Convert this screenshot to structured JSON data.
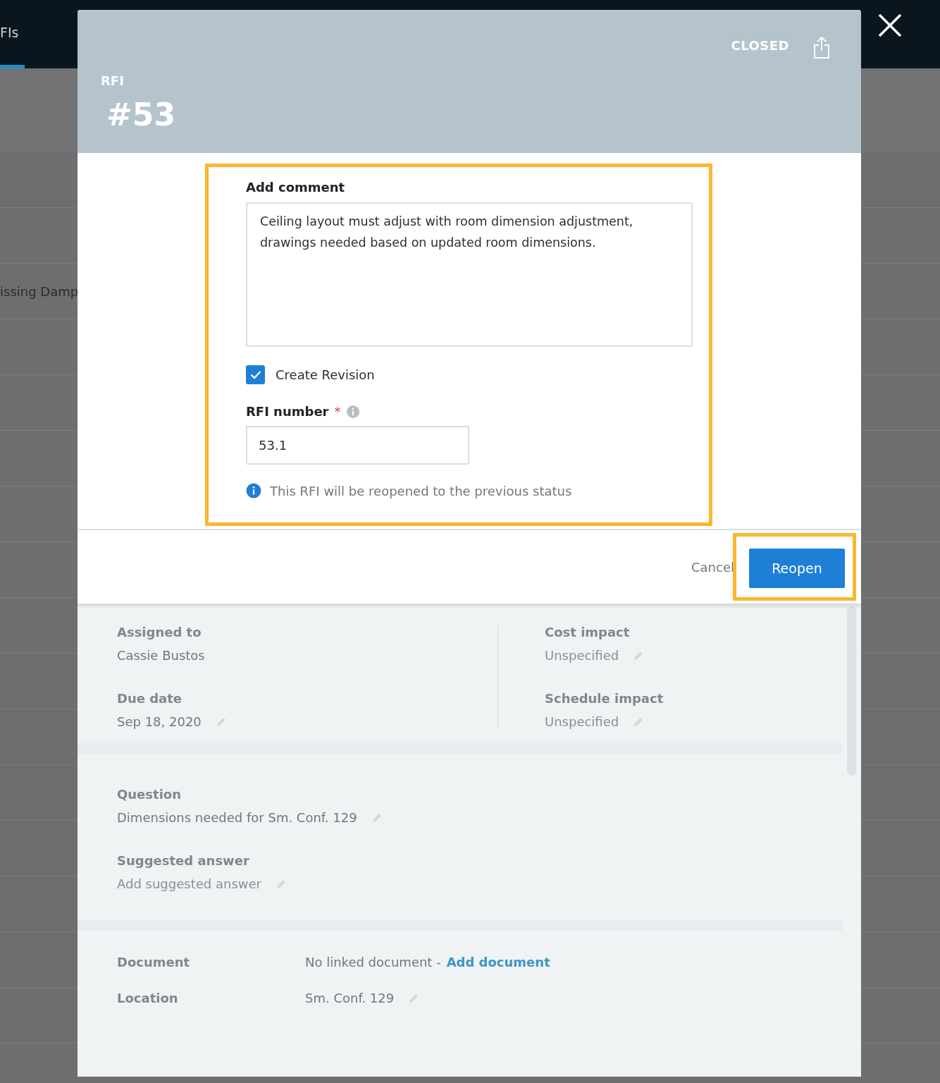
{
  "background": {
    "tab": {
      "label": "FIs",
      "selected": true
    },
    "row_text": "issing Damp"
  },
  "header": {
    "type_label": "RFI",
    "number": "#53",
    "status": "CLOSED"
  },
  "reopen_form": {
    "comment_label": "Add comment",
    "comment": "Ceiling layout must adjust with room dimension adjustment, drawings needed based on updated room dimensions.",
    "create_revision": {
      "label": "Create Revision",
      "checked": true
    },
    "rfi_number": {
      "label": "RFI number",
      "required_mark": "*",
      "value": "53.1"
    },
    "notice": "This RFI will be reopened to the previous status"
  },
  "footer": {
    "buttons": [
      {
        "label": "Cancel",
        "kind": "text"
      },
      {
        "label": "Reopen",
        "kind": "primary"
      }
    ]
  },
  "details": {
    "left": [
      {
        "label": "Assigned to",
        "value": "Cassie Bustos",
        "editable": false
      },
      {
        "label": "Due date",
        "value": "Sep 18, 2020",
        "editable": true
      }
    ],
    "right": [
      {
        "label": "Cost impact",
        "placeholder": "Unspecified",
        "editable": true
      },
      {
        "label": "Schedule impact",
        "placeholder": "Unspecified",
        "editable": true
      }
    ],
    "texts": [
      {
        "label": "Question",
        "value": "Dimensions needed for Sm. Conf. 129",
        "editable": true
      },
      {
        "label": "Suggested answer",
        "placeholder": "Add suggested answer",
        "editable": true
      }
    ],
    "links": [
      {
        "label": "Document",
        "value": "No linked document -",
        "link": "Add document",
        "editable": false
      },
      {
        "label": "Location",
        "value": "Sm. Conf. 129",
        "editable": true
      }
    ]
  }
}
